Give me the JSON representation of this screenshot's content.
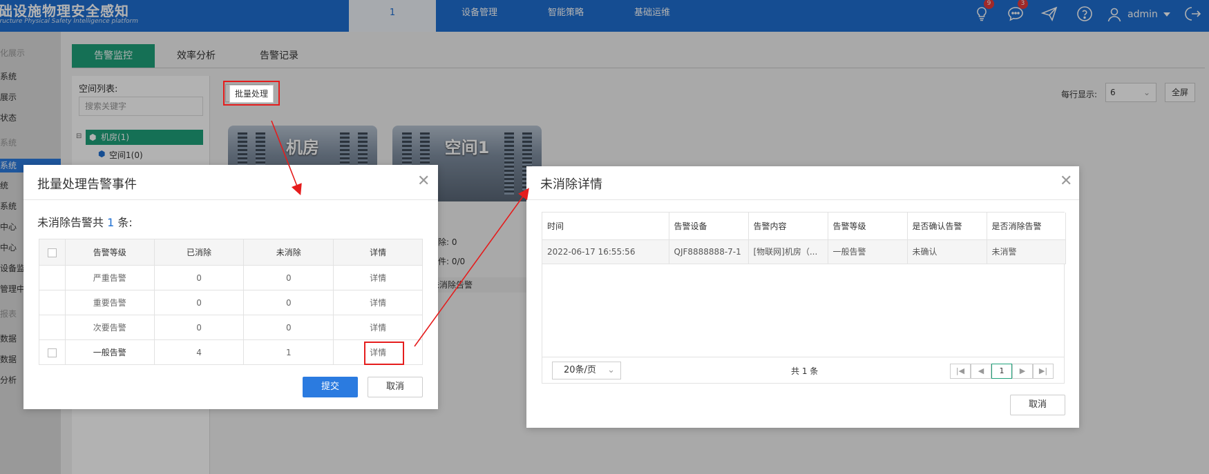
{
  "app": {
    "title": "础设施物理安全感知",
    "subtitle": "tructure Physical Safety Intelligence platform"
  },
  "topnav": {
    "active": "1",
    "items": [
      "设备管理",
      "智能策略",
      "基础运维"
    ],
    "badges": {
      "bulb": "9",
      "chat": "3"
    },
    "user": "admin"
  },
  "sidebar": {
    "items": [
      "化展示",
      "系统",
      "展示",
      "状态",
      "系统",
      "系统",
      "统",
      "系统",
      "中心",
      "中心",
      "设备监",
      "管理中心",
      "报表",
      "数据",
      "数据",
      "分析"
    ]
  },
  "tabs": [
    "告警监控",
    "效率分析",
    "告警记录"
  ],
  "space_panel": {
    "label": "空间列表:",
    "search_placeholder": "搜索关键字",
    "nodes": [
      "机房(1)",
      "空间1(0)"
    ]
  },
  "toolbar": {
    "batch": "批量处理",
    "perpage_label": "每行显示:",
    "perpage_value": "6",
    "fullscreen": "全屏"
  },
  "cards": [
    {
      "title": "机房"
    },
    {
      "title": "空间1"
    }
  ],
  "card_info": {
    "line1": "除: 0",
    "line2": "件: 0/0",
    "strip": "否无未消除告警"
  },
  "modal_batch": {
    "title": "批量处理告警事件",
    "summary_prefix": "未消除告警共",
    "summary_count": "1",
    "summary_suffix": "条:",
    "columns": [
      "告警等级",
      "已消除",
      "未消除",
      "详情"
    ],
    "rows": [
      {
        "level": "严重告警",
        "cleared": "0",
        "uncleared": "0",
        "detail": "详情"
      },
      {
        "level": "重要告警",
        "cleared": "0",
        "uncleared": "0",
        "detail": "详情"
      },
      {
        "level": "次要告警",
        "cleared": "0",
        "uncleared": "0",
        "detail": "详情"
      },
      {
        "level": "一般告警",
        "cleared": "4",
        "uncleared": "1",
        "detail": "详情"
      }
    ],
    "submit": "提交",
    "cancel": "取消"
  },
  "modal_detail": {
    "title": "未消除详情",
    "columns": [
      "时间",
      "告警设备",
      "告警内容",
      "告警等级",
      "是否确认告警",
      "是否消除告警"
    ],
    "rows": [
      {
        "time": "2022-06-17 16:55:56",
        "device": "QJF8888888-7-1",
        "content": "[物联网]机房（...",
        "level": "一般告警",
        "confirmed": "未确认",
        "cleared": "未消警"
      }
    ],
    "page_size": "20条/页",
    "total": "共 1 条",
    "current_page": "1",
    "cancel": "取消"
  },
  "colors": {
    "brand": "#1f6fd1",
    "accent": "#1fa17a",
    "highlight": "#e51c1c"
  }
}
